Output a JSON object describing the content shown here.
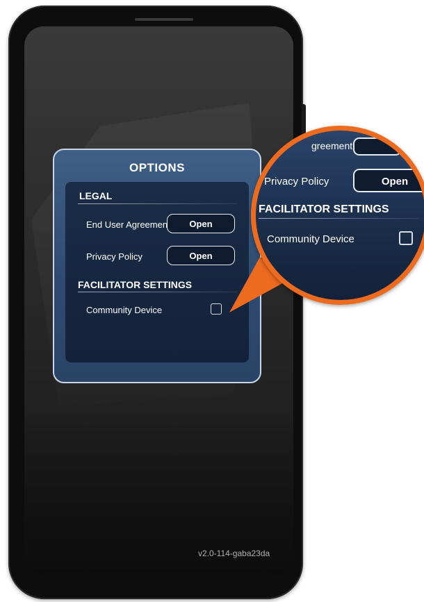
{
  "dialog": {
    "title": "OPTIONS",
    "legal": {
      "heading": "LEGAL",
      "items": [
        {
          "label": "End User Agreement",
          "button": "Open"
        },
        {
          "label": "Privacy Policy",
          "button": "Open"
        }
      ]
    },
    "facilitator": {
      "heading": "FACILITATOR SETTINGS",
      "community_device": {
        "label": "Community Device",
        "checked": false
      }
    }
  },
  "version": "v2.0-114-gaba23da",
  "magnifier": {
    "partial_label": "greement",
    "privacy_label": "Privacy Policy",
    "privacy_button": "Open",
    "facilitator_heading": "FACILITATOR SETTINGS",
    "community_label": "Community Device"
  },
  "colors": {
    "accent": "#ec6b1f",
    "dialog": "#3f5f86",
    "panel": "#13223a"
  }
}
